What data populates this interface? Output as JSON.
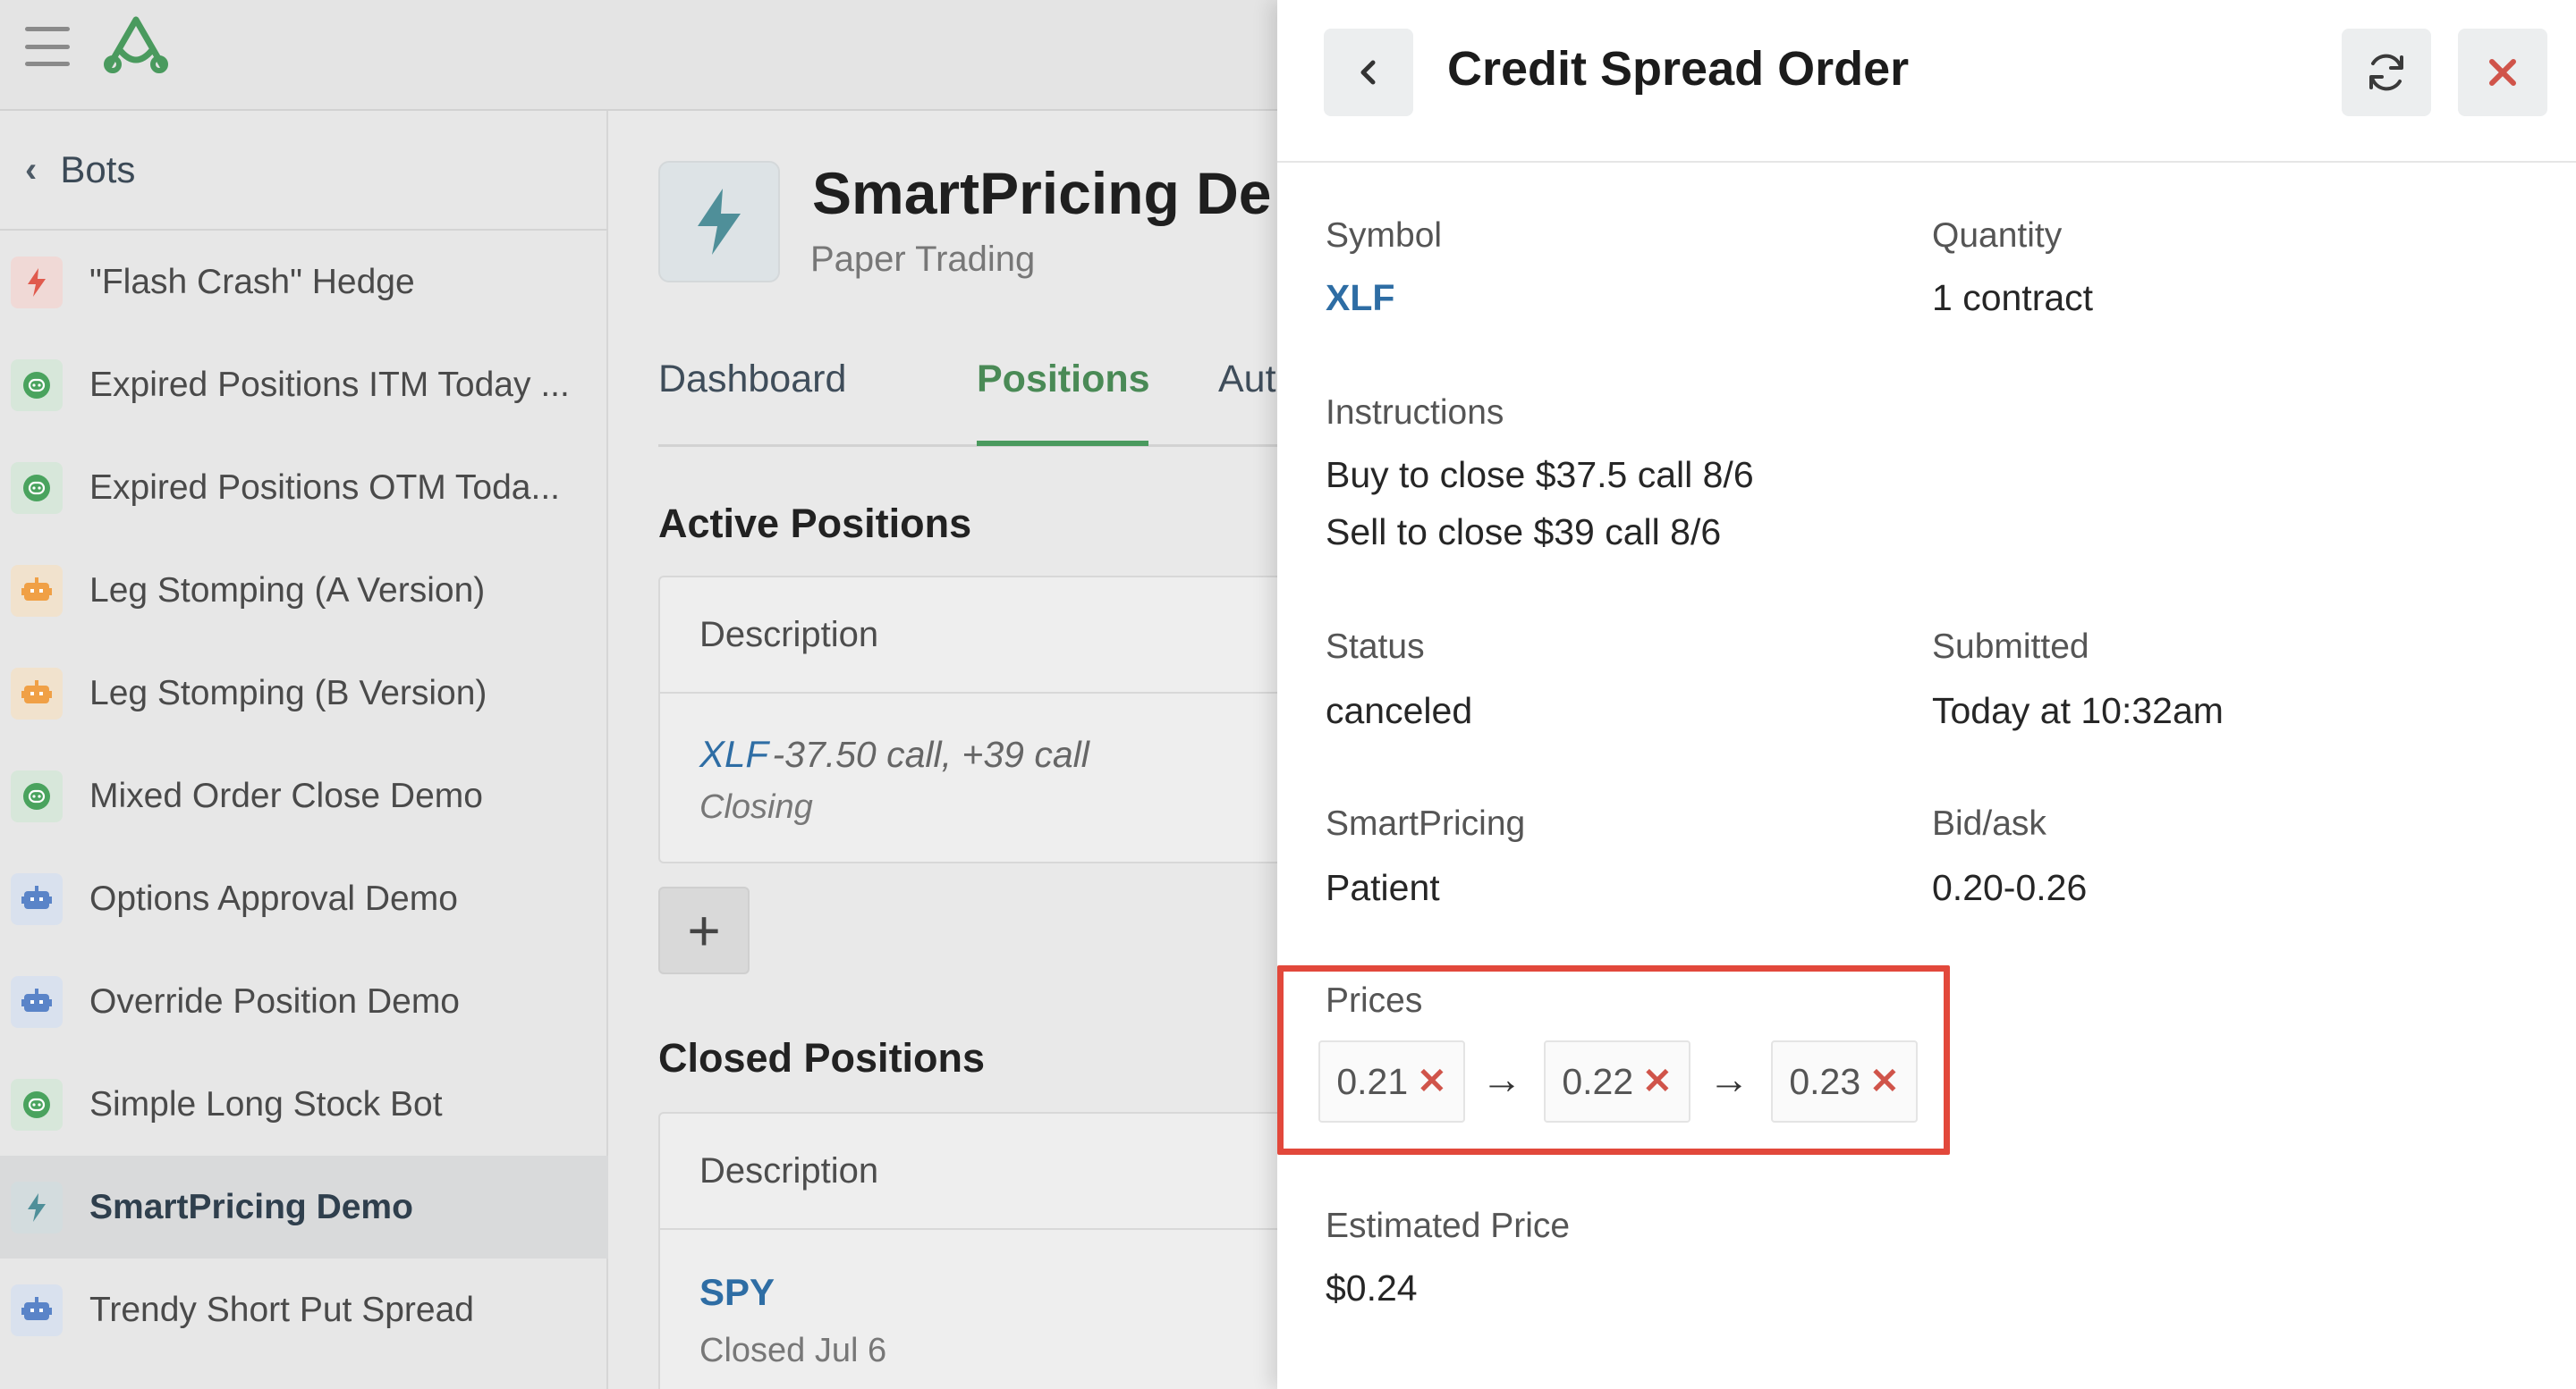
{
  "sidebar": {
    "back_label": "Bots",
    "items": [
      {
        "name": "\"Flash Crash\" Hedge",
        "icon": "lightning-icon",
        "color": "#e05a4d",
        "active": false
      },
      {
        "name": "Expired Positions ITM Today ...",
        "icon": "robot-face-icon",
        "color": "#4aa35e",
        "active": false
      },
      {
        "name": "Expired Positions OTM Toda...",
        "icon": "robot-face-icon",
        "color": "#4aa35e",
        "active": false
      },
      {
        "name": "Leg Stomping (A Version)",
        "icon": "robot-head-icon",
        "color": "#f0a046",
        "active": false
      },
      {
        "name": "Leg Stomping (B Version)",
        "icon": "robot-head-icon",
        "color": "#f0a046",
        "active": false
      },
      {
        "name": "Mixed Order Close Demo",
        "icon": "robot-face-icon",
        "color": "#4aa35e",
        "active": false
      },
      {
        "name": "Options Approval Demo",
        "icon": "robot-head-icon",
        "color": "#5a84c8",
        "active": false
      },
      {
        "name": "Override Position Demo",
        "icon": "robot-head-icon",
        "color": "#5a84c8",
        "active": false
      },
      {
        "name": "Simple Long Stock Bot",
        "icon": "robot-face-icon",
        "color": "#4aa35e",
        "active": false
      },
      {
        "name": "SmartPricing Demo",
        "icon": "lightning-icon",
        "color": "#4f8f99",
        "active": true
      },
      {
        "name": "Trendy Short Put Spread",
        "icon": "robot-head-icon",
        "color": "#5a84c8",
        "active": false
      }
    ]
  },
  "main": {
    "bot_title": "SmartPricing De",
    "bot_subtitle": "Paper Trading",
    "tabs": [
      {
        "label": "Dashboard",
        "active": false
      },
      {
        "label": "Positions",
        "active": true
      },
      {
        "label": "Auton",
        "active": false
      }
    ],
    "active_positions": {
      "title": "Active Positions",
      "column": "Description",
      "row": {
        "symbol": "XLF",
        "desc": "-37.50 call, +39 call",
        "status": "Closing"
      }
    },
    "add_label": "+",
    "closed_positions": {
      "title": "Closed Positions",
      "column": "Description",
      "row": {
        "symbol": "SPY",
        "status": "Closed Jul 6"
      }
    }
  },
  "panel": {
    "title": "Credit Spread Order",
    "back_icon": "chevron-left-icon",
    "refresh_icon": "refresh-icon",
    "close_icon": "close-icon",
    "fields": {
      "symbol_label": "Symbol",
      "symbol_value": "XLF",
      "quantity_label": "Quantity",
      "quantity_value": "1 contract",
      "instructions_label": "Instructions",
      "instruction_1": "Buy to close $37.5 call 8/6",
      "instruction_2": "Sell to close $39 call 8/6",
      "status_label": "Status",
      "status_value": "canceled",
      "submitted_label": "Submitted",
      "submitted_value": "Today at 10:32am",
      "smartpricing_label": "SmartPricing",
      "smartpricing_value": "Patient",
      "bidask_label": "Bid/ask",
      "bidask_value": "0.20-0.26",
      "prices_label": "Prices",
      "prices": [
        "0.21",
        "0.22",
        "0.23"
      ],
      "price_cancel_mark": "✕",
      "arrow": "→",
      "estimated_label": "Estimated Price",
      "estimated_value": "$0.24"
    }
  },
  "colors": {
    "brand_green": "#4a9a5e",
    "link_blue": "#2e6da4",
    "highlight_red": "#e2483b",
    "cancel_red": "#d0544a"
  }
}
